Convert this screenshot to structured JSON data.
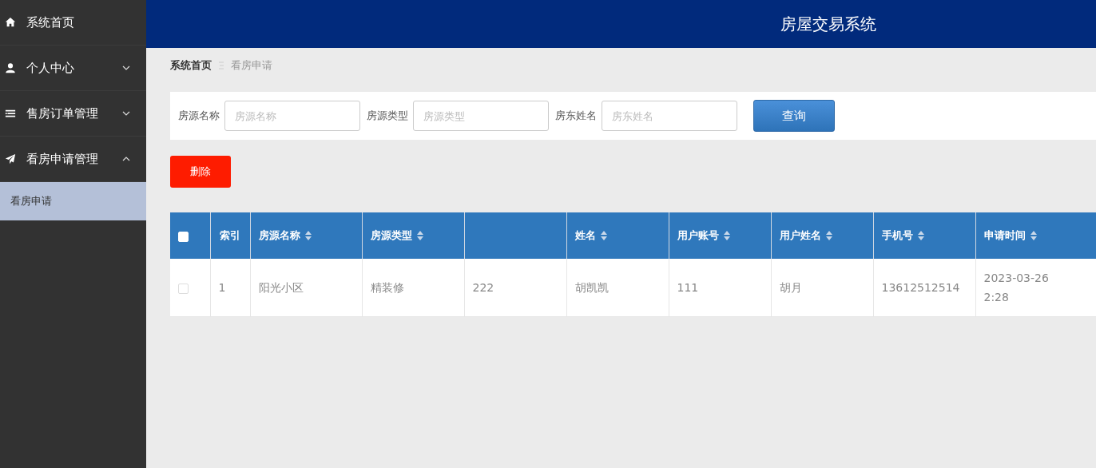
{
  "sidebar": {
    "items": [
      {
        "label": "系统首页"
      },
      {
        "label": "个人中心",
        "expanded": false
      },
      {
        "label": "售房订单管理",
        "expanded": false
      },
      {
        "label": "看房申请管理",
        "expanded": true,
        "children": [
          {
            "label": "看房申请",
            "selected": true
          }
        ]
      }
    ]
  },
  "header": {
    "title": "房屋交易系统"
  },
  "breadcrumb": [
    "系统首页",
    "看房申请"
  ],
  "search": {
    "fields": [
      {
        "label": "房源名称",
        "placeholder": "房源名称"
      },
      {
        "label": "房源类型",
        "placeholder": "房源类型"
      },
      {
        "label": "房东姓名",
        "placeholder": "房东姓名"
      }
    ],
    "button": "查询"
  },
  "delete_button": "删除",
  "table": {
    "select_all_checked": false,
    "columns": [
      {
        "label": "索引",
        "sortable": false
      },
      {
        "label": "房源名称",
        "sortable": true
      },
      {
        "label": "房源类型",
        "sortable": true
      },
      {
        "sortable": false
      },
      {
        "label": "姓名",
        "sortable": true
      },
      {
        "label": "用户账号",
        "sortable": true
      },
      {
        "label": "用户姓名",
        "sortable": true
      },
      {
        "label": "手机号",
        "sortable": true
      },
      {
        "label": "申请时间",
        "sortable": true
      }
    ],
    "rows": [
      {
        "checked": false,
        "cells": [
          "1",
          "阳光小区",
          "精装修",
          "222",
          "胡凯凯",
          "111",
          "胡月",
          "13612512514",
          [
            "2023-03-26",
            "2:28"
          ]
        ]
      }
    ]
  }
}
